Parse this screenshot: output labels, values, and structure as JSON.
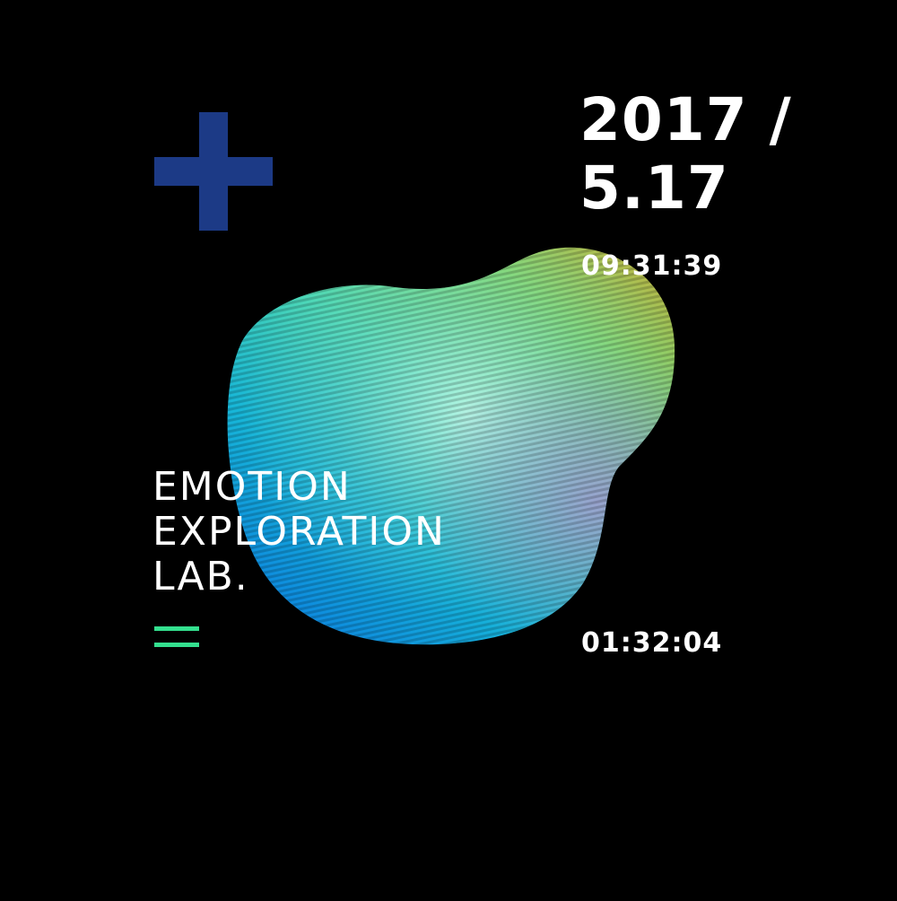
{
  "date": {
    "line1": "2017 /",
    "line2": "5.17"
  },
  "times": {
    "top": "09:31:39",
    "bottom": "01:32:04"
  },
  "title": {
    "line1": "EMOTION",
    "line2": "EXPLORATION",
    "line3": "LAB."
  },
  "icons": {
    "plus": "plus-icon",
    "menu": "menu-icon",
    "graphic": "gradient-blob"
  },
  "colors": {
    "background": "#000000",
    "plus": "#1c3a86",
    "menu": "#34e08f",
    "text": "#ffffff",
    "blob_gradient": [
      "#0a6fd8",
      "#23c7d0",
      "#7de8c8",
      "#8fcf5a",
      "#b9b348",
      "#a68cc8"
    ]
  }
}
